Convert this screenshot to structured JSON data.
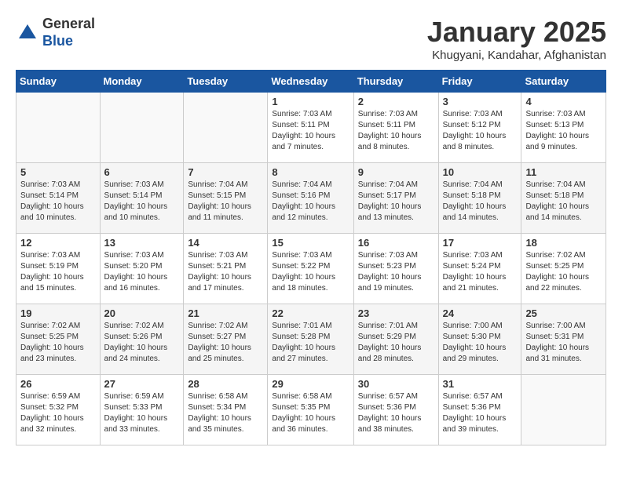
{
  "header": {
    "logo_general": "General",
    "logo_blue": "Blue",
    "title": "January 2025",
    "subtitle": "Khugyani, Kandahar, Afghanistan"
  },
  "days_of_week": [
    "Sunday",
    "Monday",
    "Tuesday",
    "Wednesday",
    "Thursday",
    "Friday",
    "Saturday"
  ],
  "weeks": [
    [
      {
        "day": "",
        "info": ""
      },
      {
        "day": "",
        "info": ""
      },
      {
        "day": "",
        "info": ""
      },
      {
        "day": "1",
        "info": "Sunrise: 7:03 AM\nSunset: 5:11 PM\nDaylight: 10 hours\nand 7 minutes."
      },
      {
        "day": "2",
        "info": "Sunrise: 7:03 AM\nSunset: 5:11 PM\nDaylight: 10 hours\nand 8 minutes."
      },
      {
        "day": "3",
        "info": "Sunrise: 7:03 AM\nSunset: 5:12 PM\nDaylight: 10 hours\nand 8 minutes."
      },
      {
        "day": "4",
        "info": "Sunrise: 7:03 AM\nSunset: 5:13 PM\nDaylight: 10 hours\nand 9 minutes."
      }
    ],
    [
      {
        "day": "5",
        "info": "Sunrise: 7:03 AM\nSunset: 5:14 PM\nDaylight: 10 hours\nand 10 minutes."
      },
      {
        "day": "6",
        "info": "Sunrise: 7:03 AM\nSunset: 5:14 PM\nDaylight: 10 hours\nand 10 minutes."
      },
      {
        "day": "7",
        "info": "Sunrise: 7:04 AM\nSunset: 5:15 PM\nDaylight: 10 hours\nand 11 minutes."
      },
      {
        "day": "8",
        "info": "Sunrise: 7:04 AM\nSunset: 5:16 PM\nDaylight: 10 hours\nand 12 minutes."
      },
      {
        "day": "9",
        "info": "Sunrise: 7:04 AM\nSunset: 5:17 PM\nDaylight: 10 hours\nand 13 minutes."
      },
      {
        "day": "10",
        "info": "Sunrise: 7:04 AM\nSunset: 5:18 PM\nDaylight: 10 hours\nand 14 minutes."
      },
      {
        "day": "11",
        "info": "Sunrise: 7:04 AM\nSunset: 5:18 PM\nDaylight: 10 hours\nand 14 minutes."
      }
    ],
    [
      {
        "day": "12",
        "info": "Sunrise: 7:03 AM\nSunset: 5:19 PM\nDaylight: 10 hours\nand 15 minutes."
      },
      {
        "day": "13",
        "info": "Sunrise: 7:03 AM\nSunset: 5:20 PM\nDaylight: 10 hours\nand 16 minutes."
      },
      {
        "day": "14",
        "info": "Sunrise: 7:03 AM\nSunset: 5:21 PM\nDaylight: 10 hours\nand 17 minutes."
      },
      {
        "day": "15",
        "info": "Sunrise: 7:03 AM\nSunset: 5:22 PM\nDaylight: 10 hours\nand 18 minutes."
      },
      {
        "day": "16",
        "info": "Sunrise: 7:03 AM\nSunset: 5:23 PM\nDaylight: 10 hours\nand 19 minutes."
      },
      {
        "day": "17",
        "info": "Sunrise: 7:03 AM\nSunset: 5:24 PM\nDaylight: 10 hours\nand 21 minutes."
      },
      {
        "day": "18",
        "info": "Sunrise: 7:02 AM\nSunset: 5:25 PM\nDaylight: 10 hours\nand 22 minutes."
      }
    ],
    [
      {
        "day": "19",
        "info": "Sunrise: 7:02 AM\nSunset: 5:25 PM\nDaylight: 10 hours\nand 23 minutes."
      },
      {
        "day": "20",
        "info": "Sunrise: 7:02 AM\nSunset: 5:26 PM\nDaylight: 10 hours\nand 24 minutes."
      },
      {
        "day": "21",
        "info": "Sunrise: 7:02 AM\nSunset: 5:27 PM\nDaylight: 10 hours\nand 25 minutes."
      },
      {
        "day": "22",
        "info": "Sunrise: 7:01 AM\nSunset: 5:28 PM\nDaylight: 10 hours\nand 27 minutes."
      },
      {
        "day": "23",
        "info": "Sunrise: 7:01 AM\nSunset: 5:29 PM\nDaylight: 10 hours\nand 28 minutes."
      },
      {
        "day": "24",
        "info": "Sunrise: 7:00 AM\nSunset: 5:30 PM\nDaylight: 10 hours\nand 29 minutes."
      },
      {
        "day": "25",
        "info": "Sunrise: 7:00 AM\nSunset: 5:31 PM\nDaylight: 10 hours\nand 31 minutes."
      }
    ],
    [
      {
        "day": "26",
        "info": "Sunrise: 6:59 AM\nSunset: 5:32 PM\nDaylight: 10 hours\nand 32 minutes."
      },
      {
        "day": "27",
        "info": "Sunrise: 6:59 AM\nSunset: 5:33 PM\nDaylight: 10 hours\nand 33 minutes."
      },
      {
        "day": "28",
        "info": "Sunrise: 6:58 AM\nSunset: 5:34 PM\nDaylight: 10 hours\nand 35 minutes."
      },
      {
        "day": "29",
        "info": "Sunrise: 6:58 AM\nSunset: 5:35 PM\nDaylight: 10 hours\nand 36 minutes."
      },
      {
        "day": "30",
        "info": "Sunrise: 6:57 AM\nSunset: 5:36 PM\nDaylight: 10 hours\nand 38 minutes."
      },
      {
        "day": "31",
        "info": "Sunrise: 6:57 AM\nSunset: 5:36 PM\nDaylight: 10 hours\nand 39 minutes."
      },
      {
        "day": "",
        "info": ""
      }
    ]
  ]
}
